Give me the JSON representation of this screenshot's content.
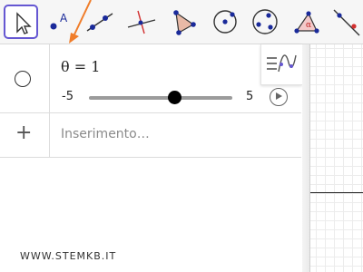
{
  "toolbar": {
    "tools": [
      {
        "name": "move-tool",
        "icon": "cursor-arrow-icon",
        "selected": true
      },
      {
        "name": "point-tool",
        "icon": "point-icon",
        "label": "A"
      },
      {
        "name": "line-tool",
        "icon": "line-icon"
      },
      {
        "name": "perpendicular-line-tool",
        "icon": "perpendicular-line-icon"
      },
      {
        "name": "polygon-tool",
        "icon": "polygon-icon"
      },
      {
        "name": "circle-center-point-tool",
        "icon": "circle-center-point-icon"
      },
      {
        "name": "circle-three-points-tool",
        "icon": "circle-three-points-icon"
      },
      {
        "name": "angle-tool",
        "icon": "angle-icon",
        "label": "α"
      },
      {
        "name": "reflect-tool",
        "icon": "reflect-line-icon"
      }
    ],
    "accent_color": "#6557d2"
  },
  "algebra": {
    "slider_row": {
      "expression": "θ = 1",
      "min_label": "-5",
      "max_label": "5",
      "value": 1,
      "min": -5,
      "max": 5
    },
    "input_row": {
      "placeholder": "Inserimento…"
    }
  },
  "watermark": "WWW.STEMKB.IT",
  "colors": {
    "annotation_arrow": "#f07d2a",
    "slider_thumb": "#000000",
    "slider_track": "#9b9b9b"
  }
}
